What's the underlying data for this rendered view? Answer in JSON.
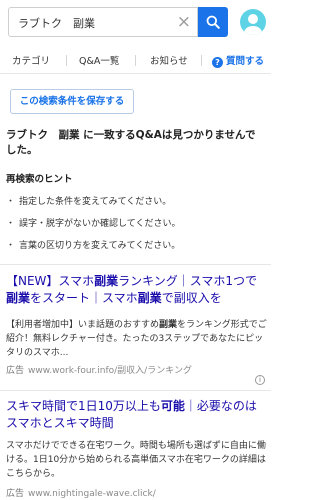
{
  "search": {
    "query": "ラブトク　副業",
    "clear_icon": "×"
  },
  "nav": {
    "category": "カテゴリ",
    "qa_list": "Q&A一覧",
    "notice": "お知らせ",
    "ask": "質問する",
    "help_icon": "?"
  },
  "save_condition": "この検索条件を保存する",
  "result": {
    "no_result": "ラブトク　副業 に一致するQ&Aは見つかりませんでした。",
    "hint_title": "再検索のヒント",
    "hints": [
      "指定した条件を変えてみてください。",
      "誤字・脱字がないか確認してください。",
      "言葉の区切り方を変えてみてください。"
    ]
  },
  "ads": [
    {
      "title_parts": [
        "【NEW】スマホ",
        "副業",
        "ランキング｜スマホ1つで",
        "副業",
        "をスタート｜スマホ",
        "副業",
        "で副収入を"
      ],
      "desc_parts": [
        "【利用者増加中】いま話題のおすすめ",
        "副業",
        "をランキング形式でご紹介！無料レクチャー付き。たったの3ステップであなたにピッタリのスマホ..."
      ],
      "label": "広告",
      "url": "www.work-four.info/副収入/ランキング"
    },
    {
      "title_parts": [
        "スキマ時間で1日10万以上も",
        "可能",
        "｜必要なのはスマホとスキマ時間"
      ],
      "desc": "スマホだけでできる在宅ワーク。時間も場所も選ばずに自由に働ける。1日10分から始められる高単価スマホ在宅ワークの詳細はこちらから。",
      "label": "広告",
      "url": "www.nightingale-wave.click/"
    }
  ],
  "colors": {
    "accent": "#1a73e8",
    "ad_title": "#1a0dab",
    "avatar": "#5fd3e6"
  }
}
